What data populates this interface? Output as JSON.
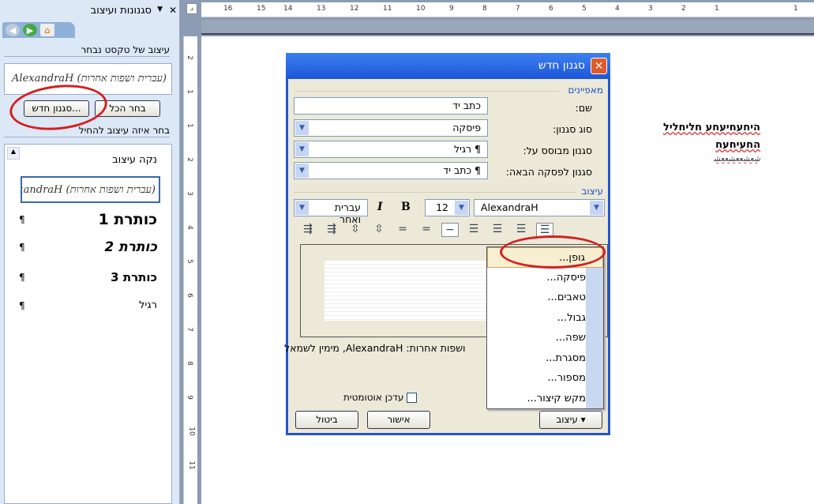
{
  "task_pane": {
    "title": "סגנונות ועיצוב",
    "close": "✕",
    "menu_arrow": "▼",
    "section_selected": "עיצוב של טקסט נבחר",
    "selected_preview": "(עברית ושפות אחרות) AlexandraH",
    "select_all": "בחר הכל",
    "new_style": "סגנון חדש...",
    "section_apply": "בחר איזה עיצוב להחיל",
    "items": [
      {
        "label": "נקה עיצוב",
        "mark": ""
      },
      {
        "label": "(עברית ושפות אחרות) AlexandraH",
        "mark": ""
      },
      {
        "label": "כותרת 1",
        "mark": "¶"
      },
      {
        "label": "כותרת 2",
        "mark": "¶"
      },
      {
        "label": "כותרת 3",
        "mark": "¶"
      },
      {
        "label": "רגיל",
        "mark": "¶"
      }
    ]
  },
  "ruler": {
    "numbers": [
      "16",
      "15",
      "14",
      "13",
      "12",
      "11",
      "10",
      "9",
      "8",
      "7",
      "6",
      "5",
      "4",
      "3",
      "2",
      "1",
      "1"
    ],
    "vnumbers": [
      "2",
      "1",
      "1",
      "2",
      "3",
      "4",
      "5",
      "6",
      "7",
      "8",
      "9",
      "10",
      "11"
    ]
  },
  "document": {
    "line1": "היחעחיעחע חליחליל",
    "line2": "החעיחעח",
    "line3": "ﺷﻌﺸﻌﻌﺸﻌﻌﺸ"
  },
  "dialog": {
    "title": "סגנון חדש",
    "close": "✕",
    "group_props": "מאפיינים",
    "name_label": "שם:",
    "name_value": "כתב יד",
    "type_label": "סוג סגנון:",
    "type_value": "פיסקה",
    "based_label": "סגנון מבוסס על:",
    "based_value": "¶  רגיל",
    "next_label": "סגנון לפסקה הבאה:",
    "next_value": "¶  כתב יד",
    "group_format": "עיצוב",
    "font": "AlexandraH",
    "size": "12",
    "bold": "B",
    "italic": "I",
    "script": "עברית ואחר",
    "description": "ושפות אחרות: AlexandraH, מימין לשמאל",
    "auto_update": "עדכן אוטומטית",
    "ok": "אישור",
    "cancel": "ביטול",
    "format": "▾ עיצוב",
    "menu": [
      "גופן...",
      "פיסקה...",
      "טאבים...",
      "גבול...",
      "שפה...",
      "מסגרת...",
      "מספור...",
      "מקש קיצור..."
    ]
  }
}
